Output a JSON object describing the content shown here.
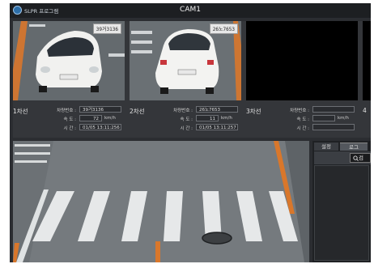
{
  "app": {
    "name": "SLPR 프로그램",
    "window_title": "CAM1"
  },
  "lanes": [
    {
      "label": "1차선",
      "plate_overlay": "39거3136",
      "plate_label": "차량번호 :",
      "plate": "39거3136",
      "speed_label": "속 도 :",
      "speed": "72",
      "speed_unit": "km/h",
      "time_label": "시 간 :",
      "time": "01/05 13:11:256"
    },
    {
      "label": "2차선",
      "plate_overlay": "26노7653",
      "plate_label": "차량번호 :",
      "plate": "26노7653",
      "speed_label": "속 도 :",
      "speed": "11",
      "speed_unit": "km/h",
      "time_label": "시 간 :",
      "time": "01/05 13:11:257"
    },
    {
      "label": "3차선",
      "plate_label": "차량번호 :",
      "plate": "",
      "speed_label": "속 도 :",
      "speed": "",
      "speed_unit": "km/h",
      "time_label": "시 간 :",
      "time": ""
    },
    {
      "label": "4"
    }
  ],
  "side_panel": {
    "tabs": [
      {
        "label": "설정"
      },
      {
        "label": "로그"
      }
    ],
    "search_label": "검"
  },
  "colors": {
    "app_bg": "#2b2d31",
    "titlebar": "#1d1f22",
    "lane_marking": "#d9772b"
  }
}
